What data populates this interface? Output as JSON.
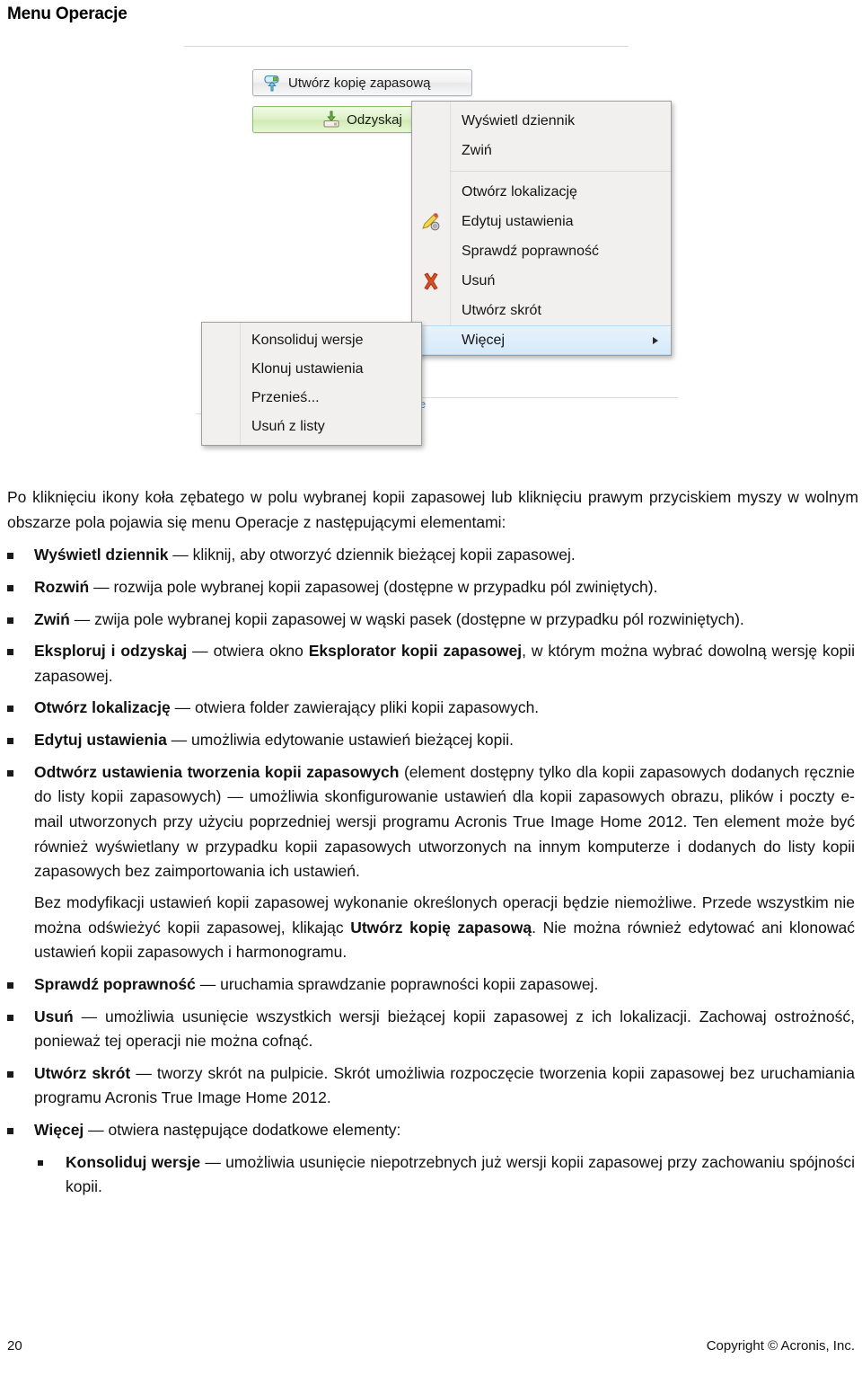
{
  "heading": "Menu Operacje",
  "screenshot": {
    "buttons": [
      {
        "label": "Utwórz kopię zapasową",
        "icon": "backup-upload-icon"
      },
      {
        "label": "Odzyskaj",
        "icon": "restore-download-icon"
      }
    ],
    "context_menu": {
      "items": [
        {
          "label": "Wyświetl dziennik",
          "icon": null,
          "highlighted": false,
          "submenu": false
        },
        {
          "label": "Zwiń",
          "icon": null,
          "highlighted": false,
          "submenu": false
        },
        {
          "separator": true
        },
        {
          "label": "Otwórz lokalizację",
          "icon": null,
          "highlighted": false,
          "submenu": false
        },
        {
          "label": "Edytuj ustawienia",
          "icon": "pencil-gear-icon",
          "highlighted": false,
          "submenu": false
        },
        {
          "label": "Sprawdź poprawność",
          "icon": null,
          "highlighted": false,
          "submenu": false
        },
        {
          "label": "Usuń",
          "icon": "red-x-icon",
          "highlighted": false,
          "submenu": false
        },
        {
          "label": "Utwórz skrót",
          "icon": null,
          "highlighted": false,
          "submenu": false
        },
        {
          "label": "Więcej",
          "icon": null,
          "highlighted": true,
          "submenu": true
        }
      ]
    },
    "submenu": {
      "items": [
        {
          "label": "Konsoliduj wersje"
        },
        {
          "label": "Klonuj ustawienia"
        },
        {
          "label": "Przenieś..."
        },
        {
          "label": "Usuń z listy"
        }
      ]
    },
    "colors": {
      "menu_bg": "#f1f0ee",
      "menu_border": "#9d9d9d",
      "highlight": "#d5e9fa",
      "restore_button": "#dcf1c6",
      "delete_icon": "#e04a20"
    }
  },
  "body": {
    "intro": "Po kliknięciu ikony koła zębatego w polu wybranej kopii zapasowej lub kliknięciu prawym przyciskiem myszy w wolnym obszarze pola pojawia się menu Operacje z następującymi elementami:",
    "bullets": [
      {
        "term": "Wyświetl dziennik",
        "rest": " — kliknij, aby otworzyć dziennik bieżącej kopii zapasowej."
      },
      {
        "term": "Rozwiń",
        "rest": " — rozwija pole wybranej kopii zapasowej (dostępne w przypadku pól zwiniętych)."
      },
      {
        "term": "Zwiń",
        "rest": " — zwija pole wybranej kopii zapasowej w wąski pasek (dostępne w przypadku pól rozwiniętych)."
      },
      {
        "term": "Eksploruj i odzyskaj",
        "rest": " — otwiera okno ",
        "term2": "Eksplorator kopii zapasowej",
        "rest2": ", w którym można wybrać dowolną wersję kopii zapasowej."
      },
      {
        "term": "Otwórz lokalizację",
        "rest": " — otwiera folder zawierający pliki kopii zapasowych."
      },
      {
        "term": "Edytuj ustawienia",
        "rest": " — umożliwia edytowanie ustawień bieżącej kopii."
      },
      {
        "term": "Odtwórz ustawienia tworzenia kopii zapasowych",
        "rest": " (element dostępny tylko dla kopii zapasowych dodanych ręcznie do listy kopii zapasowych) — umożliwia skonfigurowanie ustawień dla kopii zapasowych obrazu, plików i poczty e-mail utworzonych przy użyciu poprzedniej wersji programu Acronis True Image Home 2012. Ten element może być również wyświetlany w przypadku kopii zapasowych utworzonych na innym komputerze i dodanych do listy kopii zapasowych bez zaimportowania ich ustawień.",
        "sub_para_a": "Bez modyfikacji ustawień kopii zapasowej wykonanie określonych operacji będzie niemożliwe. Przede wszystkim nie można odświeżyć kopii zapasowej, klikając ",
        "sub_para_term": "Utwórz kopię zapasową",
        "sub_para_b": ". Nie można również edytować ani klonować ustawień kopii zapasowych i harmonogramu."
      },
      {
        "term": "Sprawdź poprawność",
        "rest": " — uruchamia sprawdzanie poprawności kopii zapasowej."
      },
      {
        "term": "Usuń",
        "rest": " — umożliwia usunięcie wszystkich wersji bieżącej kopii zapasowej z ich lokalizacji. Zachowaj ostrożność, ponieważ tej operacji nie można cofnąć."
      },
      {
        "term": "Utwórz skrót",
        "rest": " — tworzy skrót na pulpicie. Skrót umożliwia rozpoczęcie tworzenia kopii zapasowej bez uruchamiania programu Acronis True Image Home 2012."
      },
      {
        "term": "Więcej",
        "rest": " — otwiera następujące dodatkowe elementy:"
      }
    ],
    "nested_bullet": {
      "term": "Konsoliduj wersje",
      "rest": " — umożliwia usunięcie niepotrzebnych już wersji kopii zapasowej przy zachowaniu spójności kopii."
    }
  },
  "footer": {
    "page_number": "20",
    "copyright": "Copyright © Acronis, Inc."
  }
}
